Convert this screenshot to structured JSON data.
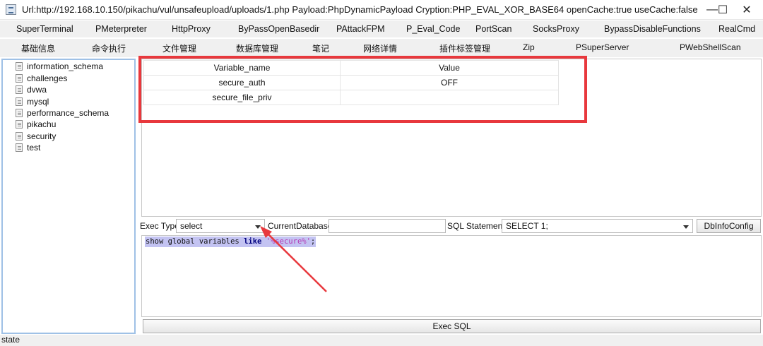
{
  "window": {
    "title": "Url:http://192.168.10.150/pikachu/vul/unsafeupload/uploads/1.php Payload:PhpDynamicPayload Cryption:PHP_EVAL_XOR_BASE64 openCache:true useCache:false",
    "minimize": "—",
    "maximize": "☐",
    "close": "✕"
  },
  "plugin_menu": [
    "SuperTerminal",
    "PMeterpreter",
    "HttpProxy",
    "ByPassOpenBasedir",
    "PAttackFPM",
    "P_Eval_Code",
    "PortScan",
    "SocksProxy",
    "BypassDisableFunctions",
    "RealCmd"
  ],
  "tabs": [
    "基础信息",
    "命令执行",
    "文件管理",
    "数据库管理",
    "笔记",
    "网络详情",
    "插件标签管理",
    "Zip",
    "PSuperServer",
    "PWebShellScan"
  ],
  "active_tab": "数据库管理",
  "databases": [
    "information_schema",
    "challenges",
    "dvwa",
    "mysql",
    "performance_schema",
    "pikachu",
    "security",
    "test"
  ],
  "result_table": {
    "columns": [
      "Variable_name",
      "Value"
    ],
    "rows": [
      [
        "secure_auth",
        "OFF"
      ],
      [
        "secure_file_priv",
        ""
      ]
    ]
  },
  "controls": {
    "exec_type_label": "Exec Type",
    "exec_type_value": "select",
    "current_db_label": "CurrentDatabase",
    "current_db_value": "",
    "sql_statement_label": "SQL Statement",
    "sql_statement_value": "SELECT 1;",
    "dbinfo_button": "DbInfoConfig"
  },
  "sql_editor": {
    "part1": "show global variables ",
    "keyword": "like",
    "part2": " ",
    "string": "'%secure%'",
    "part3": ";"
  },
  "exec_button": "Exec SQL",
  "status": "state",
  "colors": {
    "highlight_border": "#e8383d",
    "annotation_arrow": "#e8383d",
    "tree_border": "#9fc1e6",
    "sql_selection": "#c3c3f2",
    "sql_keyword": "#00007f",
    "sql_string": "#b43ab4"
  }
}
